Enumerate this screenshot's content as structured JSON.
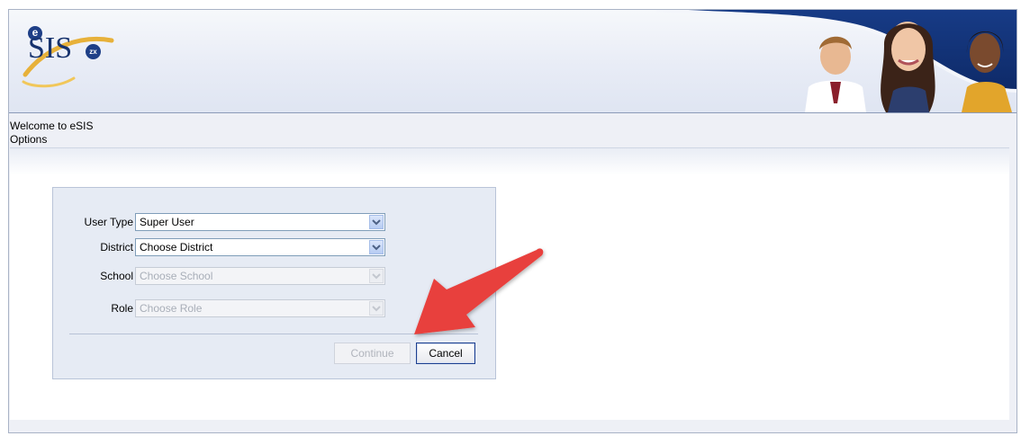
{
  "app": {
    "logo_text": "SIS",
    "logo_prefix": "e",
    "logo_badge": "zx"
  },
  "page": {
    "welcome": "Welcome to eSIS",
    "subtitle": "Options"
  },
  "form": {
    "user_type": {
      "label": "User Type",
      "value": "Super User",
      "enabled": true
    },
    "district": {
      "label": "District",
      "value": "Choose District",
      "enabled": true
    },
    "school": {
      "label": "School",
      "value": "Choose School",
      "enabled": false
    },
    "role": {
      "label": "Role",
      "value": "Choose Role",
      "enabled": false
    },
    "continue_label": "Continue",
    "cancel_label": "Cancel"
  },
  "colors": {
    "brand": "#16326d",
    "annotation_arrow": "#e8403d",
    "panel_bg": "#e6ebf4"
  },
  "icons": {
    "dropdown": "chevron-down-icon",
    "annotation": "red-arrow-icon"
  }
}
